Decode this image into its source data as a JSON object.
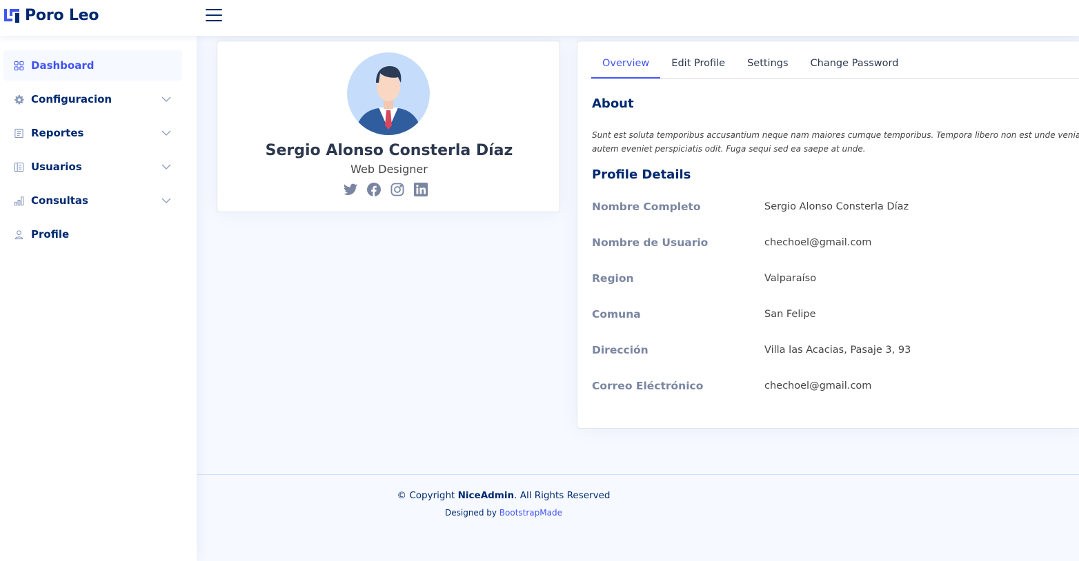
{
  "app": {
    "logo_text": "Poro Leo"
  },
  "colors": {
    "accent": "#4154f1",
    "navy": "#012970",
    "muted_label": "#7a86a1",
    "background": "#f6f9ff"
  },
  "sidebar": {
    "items": [
      {
        "label": "Dashboard",
        "icon": "grid-icon",
        "active": true,
        "has_chevron": false
      },
      {
        "label": "Configuracion",
        "icon": "gear-icon",
        "active": false,
        "has_chevron": true
      },
      {
        "label": "Reportes",
        "icon": "report-icon",
        "active": false,
        "has_chevron": true
      },
      {
        "label": "Usuarios",
        "icon": "layout-icon",
        "active": false,
        "has_chevron": true
      },
      {
        "label": "Consultas",
        "icon": "bar-chart-icon",
        "active": false,
        "has_chevron": true
      },
      {
        "label": "Profile",
        "icon": "person-icon",
        "active": false,
        "has_chevron": false
      }
    ]
  },
  "profile": {
    "name": "Sergio Alonso Consterla Díaz",
    "role": "Web Designer",
    "socials": [
      "twitter-icon",
      "facebook-icon",
      "instagram-icon",
      "linkedin-icon"
    ]
  },
  "tabs": [
    {
      "label": "Overview",
      "active": true
    },
    {
      "label": "Edit Profile",
      "active": false
    },
    {
      "label": "Settings",
      "active": false
    },
    {
      "label": "Change Password",
      "active": false
    }
  ],
  "about": {
    "title": "About",
    "line1": "Sunt est soluta temporibus accusantium neque nam maiores cumque temporibus. Tempora libero non est unde veniam est",
    "line2": "autem eveniet perspiciatis odit. Fuga sequi sed ea saepe at unde."
  },
  "details": {
    "title": "Profile Details",
    "rows": [
      {
        "label": "Nombre Completo",
        "value": "Sergio Alonso Consterla Díaz"
      },
      {
        "label": "Nombre de Usuario",
        "value": "chechoel@gmail.com"
      },
      {
        "label": "Region",
        "value": "Valparaíso"
      },
      {
        "label": "Comuna",
        "value": "San Felipe"
      },
      {
        "label": "Dirección",
        "value": "Villa las Acacias, Pasaje 3, 93"
      },
      {
        "label": "Correo Eléctrónico",
        "value": "chechoel@gmail.com"
      }
    ]
  },
  "footer": {
    "copyright_prefix": "© Copyright",
    "brand": "NiceAdmin",
    "copyright_suffix": ". All Rights Reserved",
    "designed_by": "Designed by",
    "designer_link": "BootstrapMade"
  }
}
